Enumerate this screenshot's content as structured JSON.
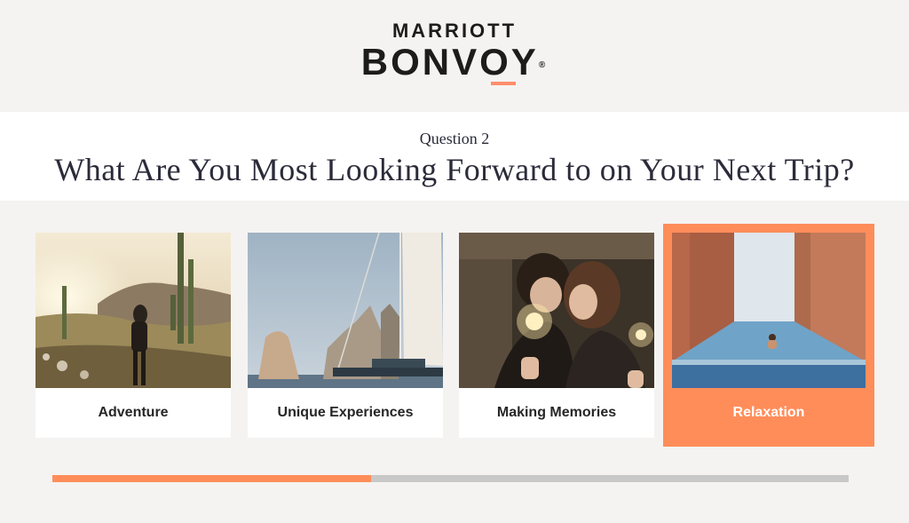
{
  "brand": {
    "line1": "MARRIOTT",
    "line2": "BONVOY",
    "registered": "®",
    "accent_color": "#ff8d5a"
  },
  "question": {
    "number_label": "Question 2",
    "text": "What Are You Most Looking Forward to on Your Next Trip?"
  },
  "options": [
    {
      "label": "Adventure",
      "selected": false,
      "image": "desert-hiker-image"
    },
    {
      "label": "Unique Experiences",
      "selected": false,
      "image": "sailboat-rocks-image"
    },
    {
      "label": "Making Memories",
      "selected": false,
      "image": "couple-sparklers-image"
    },
    {
      "label": "Relaxation",
      "selected": true,
      "image": "infinity-pool-image"
    }
  ],
  "progress": {
    "fraction": 0.4
  }
}
